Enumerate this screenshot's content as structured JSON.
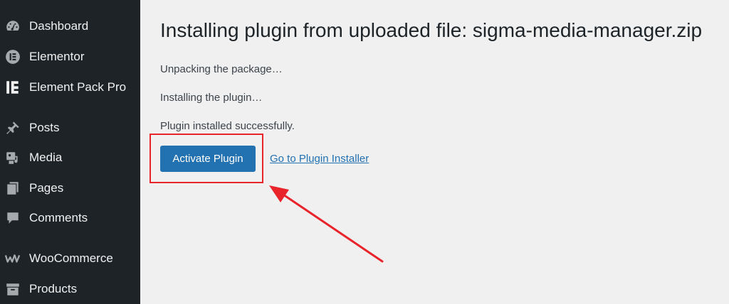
{
  "sidebar": {
    "items": [
      {
        "label": "Dashboard",
        "icon": "dashboard-icon"
      },
      {
        "label": "Elementor",
        "icon": "elementor-icon"
      },
      {
        "label": "Element Pack Pro",
        "icon": "element-pack-icon"
      },
      {
        "label": "Posts",
        "icon": "pin-icon"
      },
      {
        "label": "Media",
        "icon": "media-icon"
      },
      {
        "label": "Pages",
        "icon": "pages-icon"
      },
      {
        "label": "Comments",
        "icon": "comments-icon"
      },
      {
        "label": "WooCommerce",
        "icon": "woocommerce-icon"
      },
      {
        "label": "Products",
        "icon": "archive-icon"
      }
    ]
  },
  "main": {
    "title": "Installing plugin from uploaded file: sigma-media-manager.zip",
    "messages": [
      "Unpacking the package…",
      "Installing the plugin…",
      "Plugin installed successfully."
    ],
    "activate_label": "Activate Plugin",
    "installer_link": "Go to Plugin Installer"
  },
  "colors": {
    "sidebar_bg": "#1d2327",
    "page_bg": "#f0f0f1",
    "primary_button": "#2271b1",
    "annotation": "#e8232a"
  }
}
